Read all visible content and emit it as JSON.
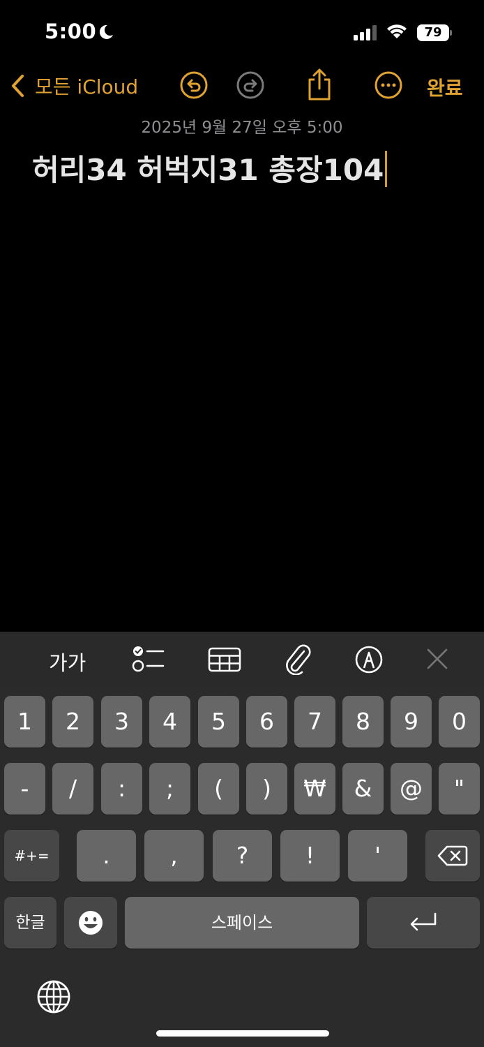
{
  "status": {
    "time": "5:00",
    "battery": "79"
  },
  "nav": {
    "back_label": "모든 iCloud",
    "done_label": "완료"
  },
  "note": {
    "date": "2025년 9월 27일 오후 5:00",
    "title": "허리34 허벅지31 총장104"
  },
  "toolbar": {
    "text_style_label": "가가"
  },
  "keyboard": {
    "row1": [
      "1",
      "2",
      "3",
      "4",
      "5",
      "6",
      "7",
      "8",
      "9",
      "0"
    ],
    "row2": [
      "-",
      "/",
      ":",
      ";",
      "(",
      ")",
      "₩",
      "&",
      "@",
      "\""
    ],
    "row3_symbols_label": "#+=",
    "row3": [
      ".",
      ",",
      "?",
      "!",
      "'"
    ],
    "lang_label": "한글",
    "space_label": "스페이스"
  },
  "accent_color": "#e0a331"
}
